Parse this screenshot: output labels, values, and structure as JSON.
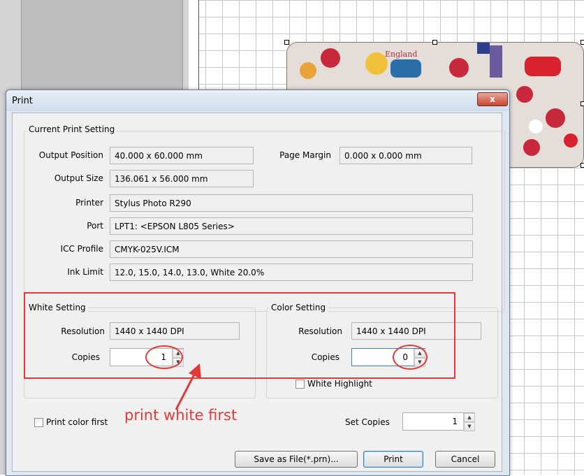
{
  "dialog": {
    "title": "Print",
    "close_glyph": "x"
  },
  "current_print_setting": {
    "group_label": "Current Print Setting",
    "rows": [
      {
        "label": "Output Position",
        "value": "40.000 x 60.000 mm"
      },
      {
        "label": "Output Size",
        "value": "136.061 x 56.000 mm"
      },
      {
        "label": "Printer",
        "value": "Stylus Photo R290"
      },
      {
        "label": "Port",
        "value": "LPT1:  <EPSON L805 Series>"
      },
      {
        "label": "ICC Profile",
        "value": "CMYK-025V.ICM"
      },
      {
        "label": "Ink Limit",
        "value": "12.0, 15.0, 14.0, 13.0, White 20.0%"
      }
    ],
    "page_margin_label": "Page Margin",
    "page_margin_value": "0.000 x 0.000 mm"
  },
  "white_setting": {
    "group_label": "White Setting",
    "resolution_label": "Resolution",
    "resolution_value": "1440 x 1440 DPI",
    "copies_label": "Copies",
    "copies_value": "1"
  },
  "color_setting": {
    "group_label": "Color Setting",
    "resolution_label": "Resolution",
    "resolution_value": "1440 x 1440 DPI",
    "copies_label": "Copies",
    "copies_value": "0",
    "white_highlight_label": "White Highlight",
    "white_highlight_checked": false
  },
  "options": {
    "print_color_first_label": "Print color first",
    "print_color_first_checked": false,
    "set_copies_label": "Set Copies",
    "set_copies_value": "1"
  },
  "buttons": {
    "save_as_file": "Save as File(*.prn)...",
    "print": "Print",
    "cancel": "Cancel"
  },
  "annotation": {
    "text": "print white first",
    "color": "#e03a3a"
  },
  "artwork": {
    "label": "England"
  },
  "icons": {
    "spin_up": "▲",
    "spin_down": "▼"
  }
}
